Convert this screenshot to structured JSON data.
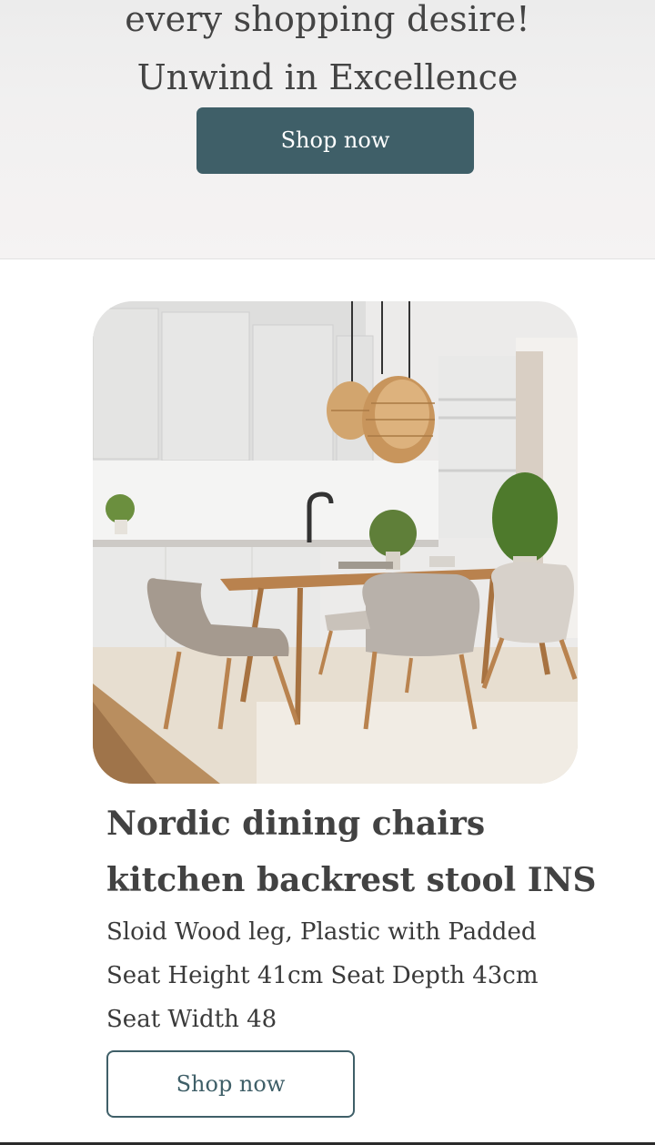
{
  "hero": {
    "line1": "every shopping desire!",
    "line2": "Unwind in Excellence",
    "button_label": "Shop now"
  },
  "product": {
    "image_alt": "Kitchen dining set with beige chairs, wooden table and rattan pendant lamps",
    "title": "Nordic dining chairs kitchen backrest stool INS",
    "description": "Sloid Wood leg, Plastic with Padded Seat Height 41cm Seat Depth 43cm Seat Width 48",
    "button_label": "Shop now"
  },
  "colors": {
    "accent": "#3f5f68",
    "hero_bg": "#f2f1f1",
    "text": "#424242"
  }
}
